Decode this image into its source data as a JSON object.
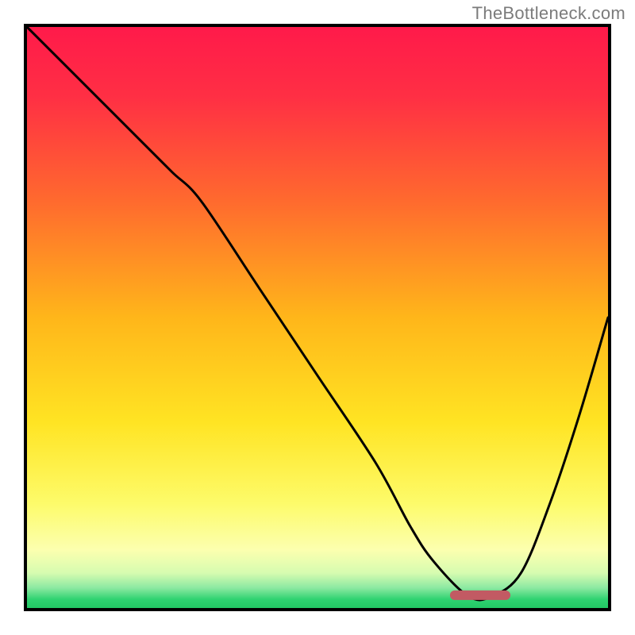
{
  "watermark": "TheBottleneck.com",
  "chart_data": {
    "type": "line",
    "title": "",
    "xlabel": "",
    "ylabel": "",
    "xlim": [
      0,
      100
    ],
    "ylim": [
      0,
      100
    ],
    "background_gradient": {
      "stops": [
        {
          "offset": 0.0,
          "color": "#ff1a4a"
        },
        {
          "offset": 0.12,
          "color": "#ff2f44"
        },
        {
          "offset": 0.3,
          "color": "#ff6a2e"
        },
        {
          "offset": 0.5,
          "color": "#ffb61a"
        },
        {
          "offset": 0.68,
          "color": "#ffe423"
        },
        {
          "offset": 0.82,
          "color": "#fdfb6a"
        },
        {
          "offset": 0.9,
          "color": "#fcffaf"
        },
        {
          "offset": 0.94,
          "color": "#d6fcb0"
        },
        {
          "offset": 0.965,
          "color": "#8de9a2"
        },
        {
          "offset": 0.985,
          "color": "#2fd371"
        },
        {
          "offset": 1.0,
          "color": "#22c864"
        }
      ]
    },
    "series": [
      {
        "name": "bottleneck-curve",
        "x": [
          0,
          10,
          20,
          25,
          30,
          40,
          50,
          60,
          66,
          70,
          76,
          80,
          85,
          90,
          95,
          100
        ],
        "y": [
          100,
          90,
          80,
          75,
          70,
          55,
          40,
          25,
          14,
          8,
          2,
          2,
          6,
          18,
          33,
          50
        ]
      }
    ],
    "marker": {
      "name": "optimal-point",
      "x_center": 78,
      "x_halfwidth": 5.2,
      "y": 2.2,
      "color": "#c25a63",
      "thickness": 12
    }
  }
}
